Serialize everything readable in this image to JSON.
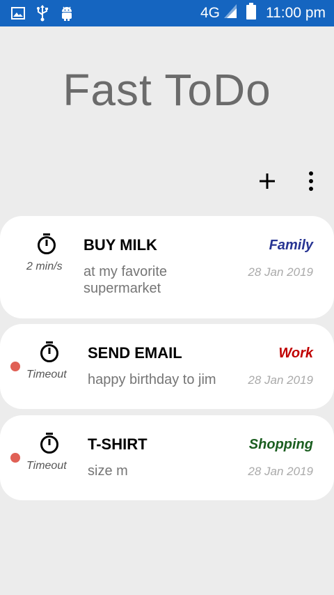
{
  "status_bar": {
    "network": "4G",
    "time": "11:00 pm"
  },
  "app": {
    "title": "Fast ToDo"
  },
  "toolbar": {
    "add_icon": "plus-icon",
    "more_icon": "more-vert-icon"
  },
  "colors": {
    "status_bar": "#1565c0",
    "background": "#ececec",
    "timeout_dot": "#e06055",
    "family": "#283593",
    "work": "#c00000",
    "shopping": "#1b5e20"
  },
  "tasks": [
    {
      "title": "BUY MILK",
      "description": "at my favorite supermarket",
      "timer": "2 min/s",
      "category": "Family",
      "date": "28 Jan 2019"
    },
    {
      "title": "SEND EMAIL",
      "description": "happy birthday to jim",
      "timer": "Timeout",
      "category": "Work",
      "date": "28 Jan 2019"
    },
    {
      "title": "T-SHIRT",
      "description": "size m",
      "timer": "Timeout",
      "category": "Shopping",
      "date": "28 Jan 2019"
    }
  ]
}
